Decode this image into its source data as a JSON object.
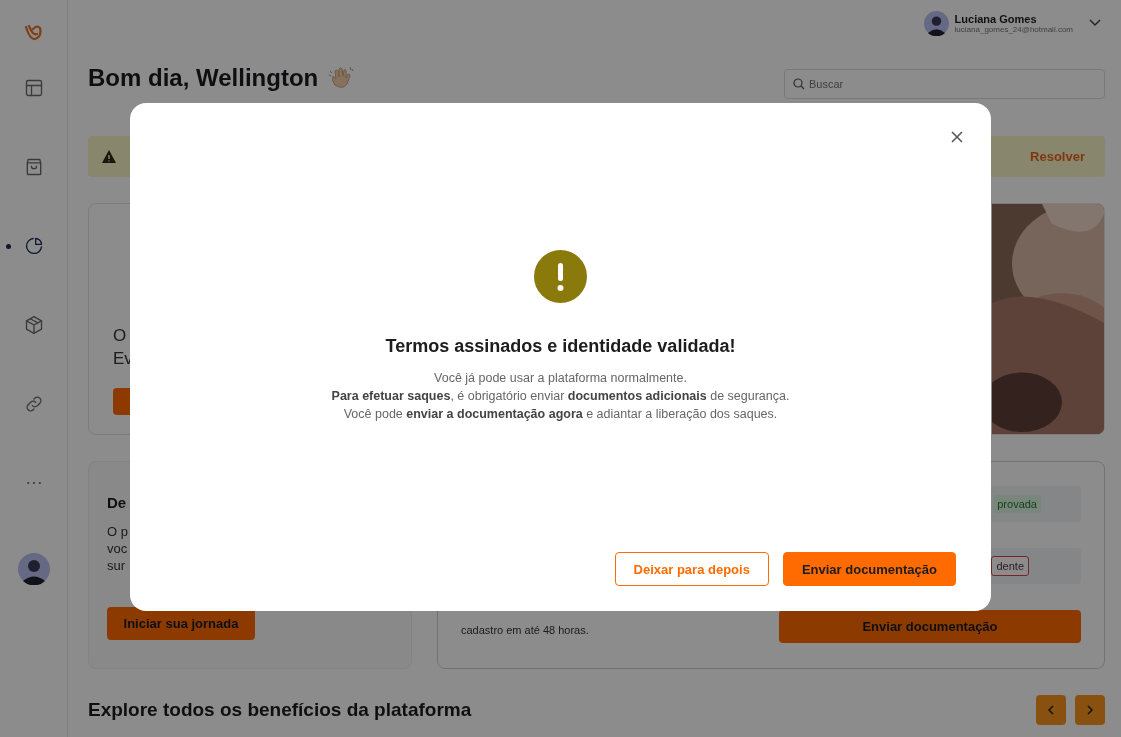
{
  "sidebar": {
    "items": [
      {
        "kind": "layout",
        "selected": false
      },
      {
        "kind": "bag",
        "selected": false
      },
      {
        "kind": "chart",
        "selected": true
      },
      {
        "kind": "box",
        "selected": false
      },
      {
        "kind": "link",
        "selected": false
      },
      {
        "kind": "more",
        "selected": false
      }
    ]
  },
  "user": {
    "name": "Luciana Gomes",
    "email": "luciana_gomes_24@hotmail.com"
  },
  "greeting": "Bom dia, Wellington",
  "search": {
    "placeholder": "Buscar"
  },
  "alert": {
    "action": "Resolver"
  },
  "hero": {
    "text_lines": [
      "O",
      "Ev"
    ]
  },
  "journey_card": {
    "title": "De",
    "text_lines": [
      "O p",
      "voc",
      "sur"
    ],
    "button": "Iniciar sua jornada"
  },
  "docs_card": {
    "text_lines": [
      "cadastro em até 48 horas."
    ],
    "statuses": [
      {
        "label": "provada",
        "kind": "approved"
      },
      {
        "label": "dente",
        "kind": "pending"
      }
    ],
    "button": "Enviar documentação"
  },
  "benefits": {
    "title": "Explore todos os benefícios da plataforma"
  },
  "modal": {
    "title": "Termos assinados e identidade validada!",
    "lines": [
      "Você já pode usar a plataforma normalmente.",
      "**Para efetuar saques**, é obrigatório enviar **documentos adicionais** de segurança.",
      "Você pode **enviar a documentação agora** e adiantar a liberação dos saques."
    ],
    "buttons": [
      {
        "label": "Deixar para depois",
        "kind": "secondary"
      },
      {
        "label": "Enviar documentação",
        "kind": "primary"
      }
    ]
  }
}
